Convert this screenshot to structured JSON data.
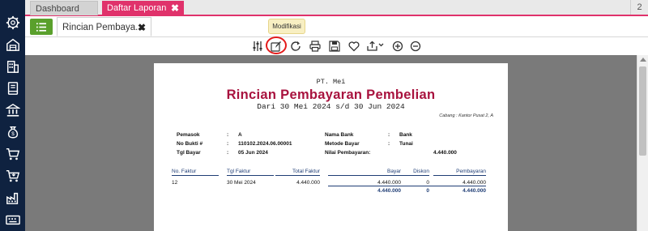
{
  "tabs": {
    "dashboard": "Dashboard",
    "laporan": "Daftar Laporan",
    "laporan_close": "✖",
    "count": "2"
  },
  "subtab": {
    "label": "Rincian Pembaya...",
    "close": "✖"
  },
  "toolbar": {
    "tooltip": "Modifikasi",
    "icons": [
      "filter-sliders-icon",
      "edit-icon",
      "refresh-icon",
      "print-icon",
      "save-icon",
      "favorite-heart-icon",
      "export-icon",
      "zoom-in-icon",
      "zoom-out-icon"
    ]
  },
  "sidebar": {
    "icons": [
      "settings-icon",
      "warehouse-icon",
      "company-building-icon",
      "book-icon",
      "bank-icon",
      "money-bag-icon",
      "cart-icon",
      "cart-in-icon",
      "factory-icon",
      "keyboard-icon"
    ]
  },
  "colors": {
    "sidebar": "#0f2240",
    "accent": "#e0326b",
    "title": "#a8123e",
    "table_header": "#1f3d75",
    "menu_green": "#5aa02c"
  },
  "report": {
    "company": "PT. Mei",
    "title": "Rincian Pembayaran Pembelian",
    "period": "Dari 30 Mei 2024 s/d 30 Jun 2024",
    "branch": "Cabang : Kantor Pusat 2, A",
    "info_left": [
      {
        "label": "Pemasok",
        "sep": ":",
        "value": "A"
      },
      {
        "label": "No Bukti #",
        "sep": ":",
        "value": "110102.2024.06.00001"
      },
      {
        "label": "Tgl Bayar",
        "sep": ":",
        "value": "05 Jun 2024"
      }
    ],
    "info_right": [
      {
        "label": "Nama Bank",
        "sep": ":",
        "value": "Bank"
      },
      {
        "label": "Metode Bayar",
        "sep": ":",
        "value": "Tunai"
      },
      {
        "label": "Nilai Pembayaran:",
        "sep": "",
        "value": "4.440.000"
      }
    ],
    "columns": [
      "No. Faktur",
      "Tgl Faktur",
      "Total Faktur",
      "Bayar",
      "Diskon",
      "Pembayaran"
    ],
    "rows": [
      {
        "no_faktur": "12",
        "tgl_faktur": "30 Mei 2024",
        "total_faktur": "4.440.000",
        "bayar": "4.440.000",
        "diskon": "0",
        "pembayaran": "4.440.000"
      }
    ],
    "totals": {
      "bayar": "4.440.000",
      "diskon": "0",
      "pembayaran": "4.440.000"
    }
  }
}
